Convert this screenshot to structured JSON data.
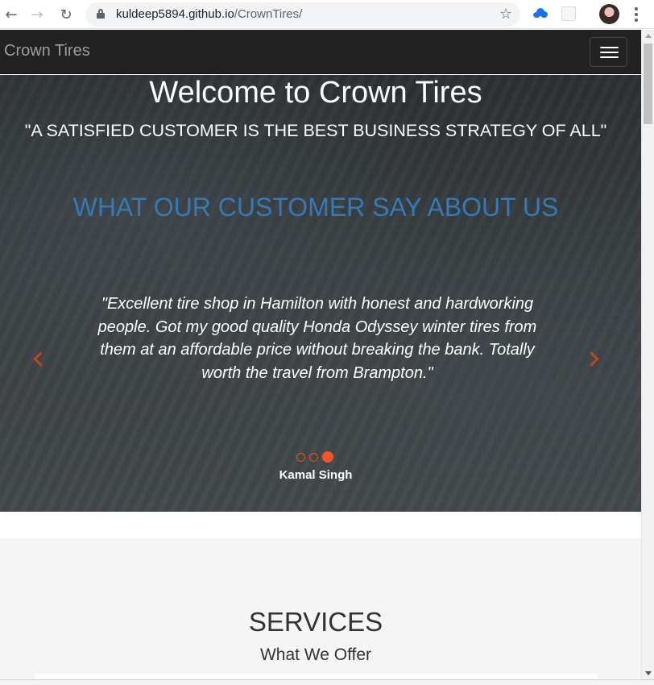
{
  "browser": {
    "url_host": "kuldeep5894.github.io",
    "url_path": "/CrownTires/",
    "back_glyph": "←",
    "forward_glyph": "→",
    "reload_glyph": "↻",
    "star_glyph": "☆"
  },
  "navbar": {
    "brand": "Crown Tires"
  },
  "hero": {
    "title": "Welcome to Crown Tires",
    "tagline": "\"A SATISFIED CUSTOMER IS THE BEST BUSINESS STRATEGY OF ALL\"",
    "subheading": "WHAT OUR CUSTOMER SAY ABOUT US",
    "accent_color": "#337ab7",
    "carousel": {
      "quote": "\"Excellent tire shop in Hamilton with honest and hardworking people. Got my good quality Honda Odyssey winter tires from them at an affordable price without breaking the bank. Totally worth the travel from Brampton.\"",
      "author": "Kamal Singh",
      "slide_count": 3,
      "active_slide": 3,
      "indicator_color": "#f2552c"
    }
  },
  "services": {
    "title": "SERVICES",
    "subtitle": "What We Offer"
  }
}
